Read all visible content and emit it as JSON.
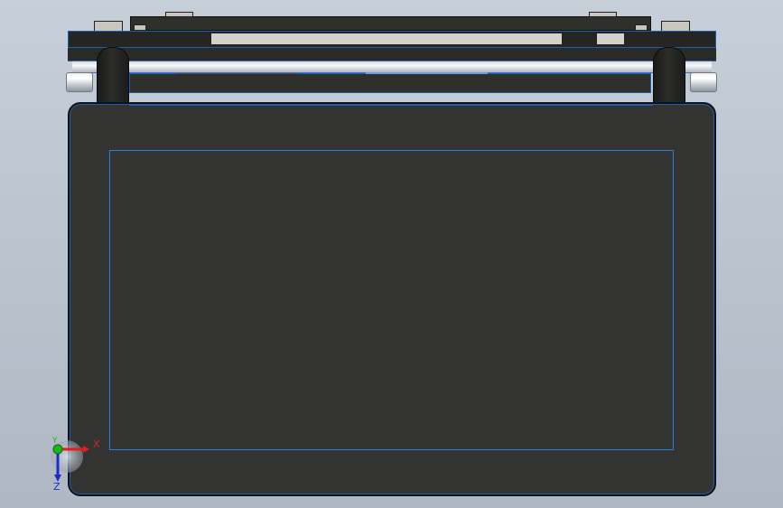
{
  "view": {
    "background": "#bcc4ce",
    "part_color": "#333431",
    "edge_color": "#1e5fb4"
  },
  "triad": {
    "x_label": "X",
    "y_label": "Y",
    "z_label": "Z",
    "x_color": "#e02020",
    "y_color": "#18b818",
    "z_color": "#1c2cc8"
  }
}
